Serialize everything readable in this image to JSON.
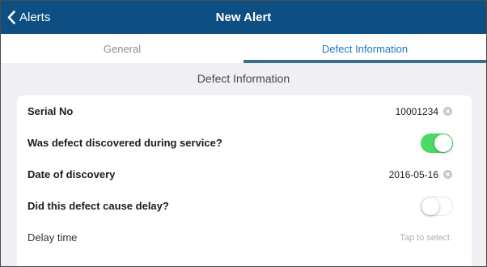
{
  "navbar": {
    "back_label": "Alerts",
    "title": "New Alert",
    "bg_color": "#0d4f82"
  },
  "tabs": [
    {
      "label": "General",
      "active": false
    },
    {
      "label": "Defect Information",
      "active": true
    }
  ],
  "section": {
    "title": "Defect Information"
  },
  "form": {
    "serial_no": {
      "label": "Serial No",
      "value": "10001234"
    },
    "discovered_during_service": {
      "label": "Was defect discovered during service?",
      "checked": true
    },
    "date_of_discovery": {
      "label": "Date of discovery",
      "value": "2016-05-16"
    },
    "caused_delay": {
      "label": "Did this defect cause delay?",
      "checked": false
    },
    "delay_time": {
      "label": "Delay time",
      "placeholder": "Tap to select"
    }
  },
  "colors": {
    "accent": "#1a7ac8",
    "toggle_on": "#4cd964"
  }
}
